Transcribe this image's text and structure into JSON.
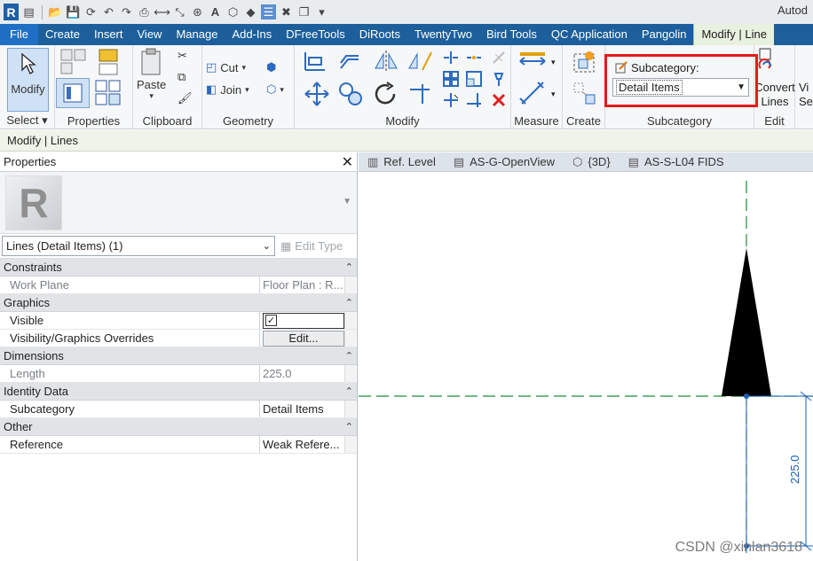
{
  "app": {
    "title": "Autod"
  },
  "ribbon_tabs": [
    "File",
    "Create",
    "Insert",
    "View",
    "Manage",
    "Add-Ins",
    "DFreeTools",
    "DiRoots",
    "TwentyTwo",
    "Bird Tools",
    "QC Application",
    "Pangolin",
    "Modify | Line"
  ],
  "ribbon": {
    "select": {
      "button": "Modify",
      "panel": "Select",
      "arrow": "▾"
    },
    "properties": {
      "panel": "Properties"
    },
    "clipboard": {
      "paste": "Paste",
      "panel": "Clipboard"
    },
    "geometry": {
      "cut": "Cut",
      "join": "Join",
      "panel": "Geometry"
    },
    "modify": {
      "panel": "Modify"
    },
    "measure": {
      "panel": "Measure"
    },
    "create": {
      "panel": "Create"
    },
    "subcategory": {
      "label": "Subcategory:",
      "value": "Detail Items",
      "panel": "Subcategory"
    },
    "edit": {
      "convert": "Convert",
      "lines": "Lines",
      "panel": "Edit",
      "vi": "Vi",
      "se": "Se"
    }
  },
  "context_bar": "Modify | Lines",
  "properties_palette": {
    "title": "Properties",
    "type_selector": "Lines (Detail Items) (1)",
    "edit_type": "Edit Type",
    "groups": [
      {
        "name": "Constraints",
        "rows": [
          {
            "key": "Work Plane",
            "value": "Floor Plan : R...",
            "readonly": true
          }
        ]
      },
      {
        "name": "Graphics",
        "rows": [
          {
            "key": "Visible",
            "value": "",
            "checkbox": true
          },
          {
            "key": "Visibility/Graphics Overrides",
            "value": "Edit...",
            "button": true
          }
        ]
      },
      {
        "name": "Dimensions",
        "rows": [
          {
            "key": "Length",
            "value": "225.0",
            "readonly": true
          }
        ]
      },
      {
        "name": "Identity Data",
        "rows": [
          {
            "key": "Subcategory",
            "value": "Detail Items"
          }
        ]
      },
      {
        "name": "Other",
        "rows": [
          {
            "key": "Reference",
            "value": "Weak Refere..."
          }
        ]
      }
    ]
  },
  "view_tabs": [
    "Ref. Level",
    "AS-G-OpenView",
    "{3D}",
    "AS-S-L04 FIDS"
  ],
  "canvas": {
    "dimension_text": "225.0"
  },
  "watermark": "CSDN @xinlan3618",
  "colors": {
    "tab_bar": "#1d5f9a",
    "active_tab": "#e8f1df",
    "highlight": "#e21c1c",
    "dim_line": "#1a5fb4",
    "ref_line": "#1e8a3a"
  }
}
